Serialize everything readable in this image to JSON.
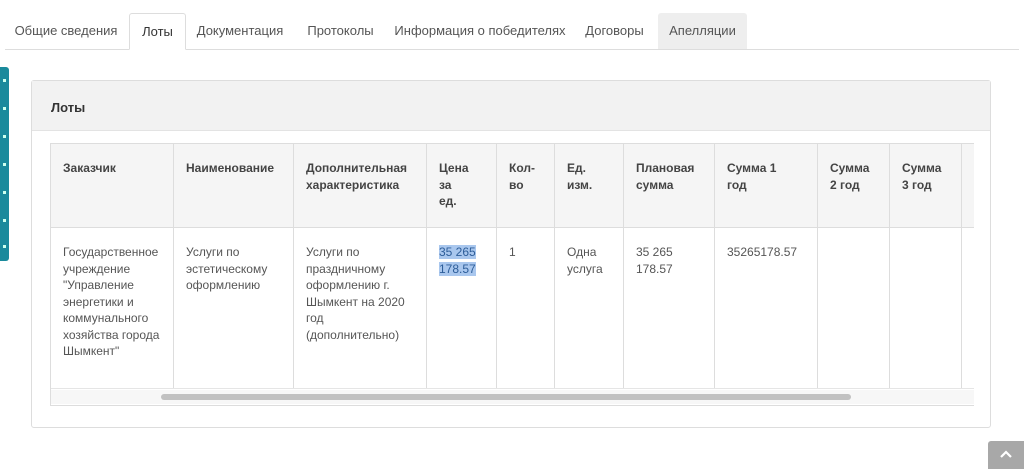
{
  "tabs": [
    {
      "label": "Общие сведения"
    },
    {
      "label": "Лоты"
    },
    {
      "label": "Документация"
    },
    {
      "label": "Протоколы"
    },
    {
      "label": "Информация о победителях"
    },
    {
      "label": "Договоры"
    },
    {
      "label": "Апелляции"
    }
  ],
  "active_tab": "Лоты",
  "panel": {
    "title": "Лоты"
  },
  "table": {
    "headers": [
      "Заказчик",
      "Наименование",
      "Дополнительная характеристика",
      "Цена за ед.",
      "Кол-во",
      "Ед. изм.",
      "Плановая сумма",
      "Сумма 1 год",
      "Сумма 2 год",
      "Сумма 3 год"
    ],
    "rows": [
      [
        "Государственное учреждение \"Управление энергетики и коммунального хозяйства города Шымкент\"",
        "Услуги по эстетическому оформлению",
        "Услуги по праздничному оформлению г. Шымкент на 2020 год (дополнительно)",
        "35 265 178.57",
        "1",
        "Одна услуга",
        "35 265 178.57",
        "35265178.57",
        "",
        ""
      ]
    ]
  },
  "selection_color": "#a9c7ee",
  "icons": {
    "scroll_top": "chevron-up-icon"
  }
}
